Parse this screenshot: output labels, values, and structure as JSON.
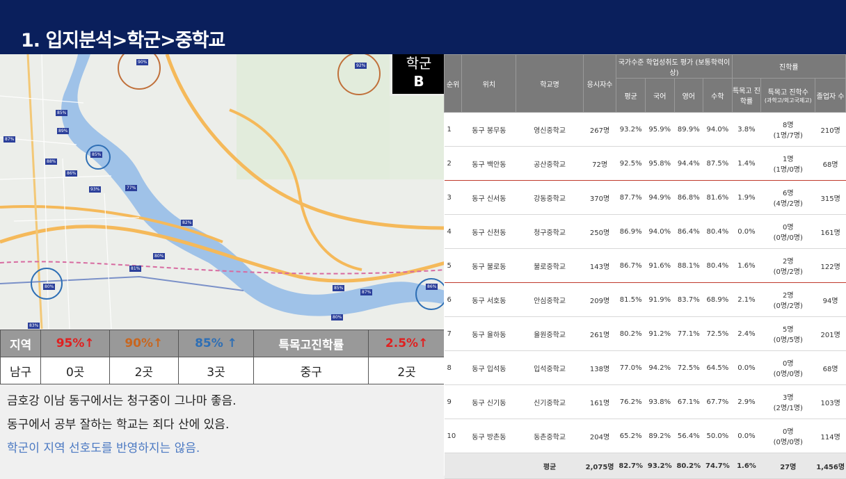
{
  "title": "1. 입지분석>학군>중학교",
  "badge": {
    "line1": "학군",
    "line2": "B"
  },
  "stats": {
    "headers": [
      "지역",
      "95%↑",
      "90%↑",
      "85% ↑",
      "특목고진학률",
      "2.5%↑"
    ],
    "values": [
      "남구",
      "0곳",
      "2곳",
      "3곳",
      "중구",
      "2곳"
    ],
    "colors": {
      "red": "#e02020",
      "orange": "#c8661f",
      "blue": "#2e6fb5"
    }
  },
  "notes": [
    "금호강 이남 동구에서는 청구중이 그나마 좋음.",
    "동구에서 공부 잘하는 학교는 죄다 산에 있음.",
    "학군이 지역 선호도를 반영하지는 않음."
  ],
  "map": {
    "labels": [
      "90%",
      "92%",
      "87%",
      "85%",
      "89%",
      "88%",
      "86%",
      "85%",
      "77%",
      "93%",
      "82%",
      "80%",
      "81%",
      "80%",
      "85%",
      "87%",
      "86%",
      "80%",
      "83%"
    ]
  },
  "ranking": {
    "headers": {
      "rank": "순위",
      "loc": "위치",
      "school": "학교명",
      "count": "응시자수",
      "national": "국가수준 학업성취도 평가 (보통학력이상)",
      "avg": "평균",
      "kor": "국어",
      "eng": "영어",
      "math": "수학",
      "progress": "진학률",
      "special_rate": "특목고 진학률",
      "special_count": "특목고 진학수",
      "special_sub": "(과학고/외고국제고)",
      "grads": "졸업자 수"
    },
    "rows": [
      {
        "rank": "1",
        "loc": "동구 봉무동",
        "school": "영신중학교",
        "count": "267명",
        "avg": "93.2%",
        "kor": "95.9%",
        "eng": "89.9%",
        "math": "94.0%",
        "rate": "3.8%",
        "sc1": "8명",
        "sc2": "(1명/7명)",
        "grads": "210명"
      },
      {
        "rank": "2",
        "loc": "동구 백안동",
        "school": "공산중학교",
        "count": "72명",
        "avg": "92.5%",
        "kor": "95.8%",
        "eng": "94.4%",
        "math": "87.5%",
        "rate": "1.4%",
        "sc1": "1명",
        "sc2": "(1명/0명)",
        "grads": "68명"
      },
      {
        "rank": "3",
        "loc": "동구 신서동",
        "school": "강동중학교",
        "count": "370명",
        "avg": "87.7%",
        "kor": "94.9%",
        "eng": "86.8%",
        "math": "81.6%",
        "rate": "1.9%",
        "sc1": "6명",
        "sc2": "(4명/2명)",
        "grads": "315명"
      },
      {
        "rank": "4",
        "loc": "동구 신천동",
        "school": "청구중학교",
        "count": "250명",
        "avg": "86.9%",
        "kor": "94.0%",
        "eng": "86.4%",
        "math": "80.4%",
        "rate": "0.0%",
        "sc1": "0명",
        "sc2": "(0명/0명)",
        "grads": "161명"
      },
      {
        "rank": "5",
        "loc": "동구 불로동",
        "school": "불로중학교",
        "count": "143명",
        "avg": "86.7%",
        "kor": "91.6%",
        "eng": "88.1%",
        "math": "80.4%",
        "rate": "1.6%",
        "sc1": "2명",
        "sc2": "(0명/2명)",
        "grads": "122명"
      },
      {
        "rank": "6",
        "loc": "동구 서호동",
        "school": "안심중학교",
        "count": "209명",
        "avg": "81.5%",
        "kor": "91.9%",
        "eng": "83.7%",
        "math": "68.9%",
        "rate": "2.1%",
        "sc1": "2명",
        "sc2": "(0명/2명)",
        "grads": "94명"
      },
      {
        "rank": "7",
        "loc": "동구 율하동",
        "school": "율원중학교",
        "count": "261명",
        "avg": "80.2%",
        "kor": "91.2%",
        "eng": "77.1%",
        "math": "72.5%",
        "rate": "2.4%",
        "sc1": "5명",
        "sc2": "(0명/5명)",
        "grads": "201명"
      },
      {
        "rank": "8",
        "loc": "동구 입석동",
        "school": "입석중학교",
        "count": "138명",
        "avg": "77.0%",
        "kor": "94.2%",
        "eng": "72.5%",
        "math": "64.5%",
        "rate": "0.0%",
        "sc1": "0명",
        "sc2": "(0명/0명)",
        "grads": "68명"
      },
      {
        "rank": "9",
        "loc": "동구 신기동",
        "school": "신기중학교",
        "count": "161명",
        "avg": "76.2%",
        "kor": "93.8%",
        "eng": "67.1%",
        "math": "67.7%",
        "rate": "2.9%",
        "sc1": "3명",
        "sc2": "(2명/1명)",
        "grads": "103명"
      },
      {
        "rank": "10",
        "loc": "동구 방촌동",
        "school": "동촌중학교",
        "count": "204명",
        "avg": "65.2%",
        "kor": "89.2%",
        "eng": "56.4%",
        "math": "50.0%",
        "rate": "0.0%",
        "sc1": "0명",
        "sc2": "(0명/0명)",
        "grads": "114명"
      }
    ],
    "avg_row": {
      "label": "평균",
      "count": "2,075명",
      "avg": "82.7%",
      "kor": "93.2%",
      "eng": "80.2%",
      "math": "74.7%",
      "rate": "1.6%",
      "sc": "27명",
      "grads": "1,456명"
    }
  }
}
